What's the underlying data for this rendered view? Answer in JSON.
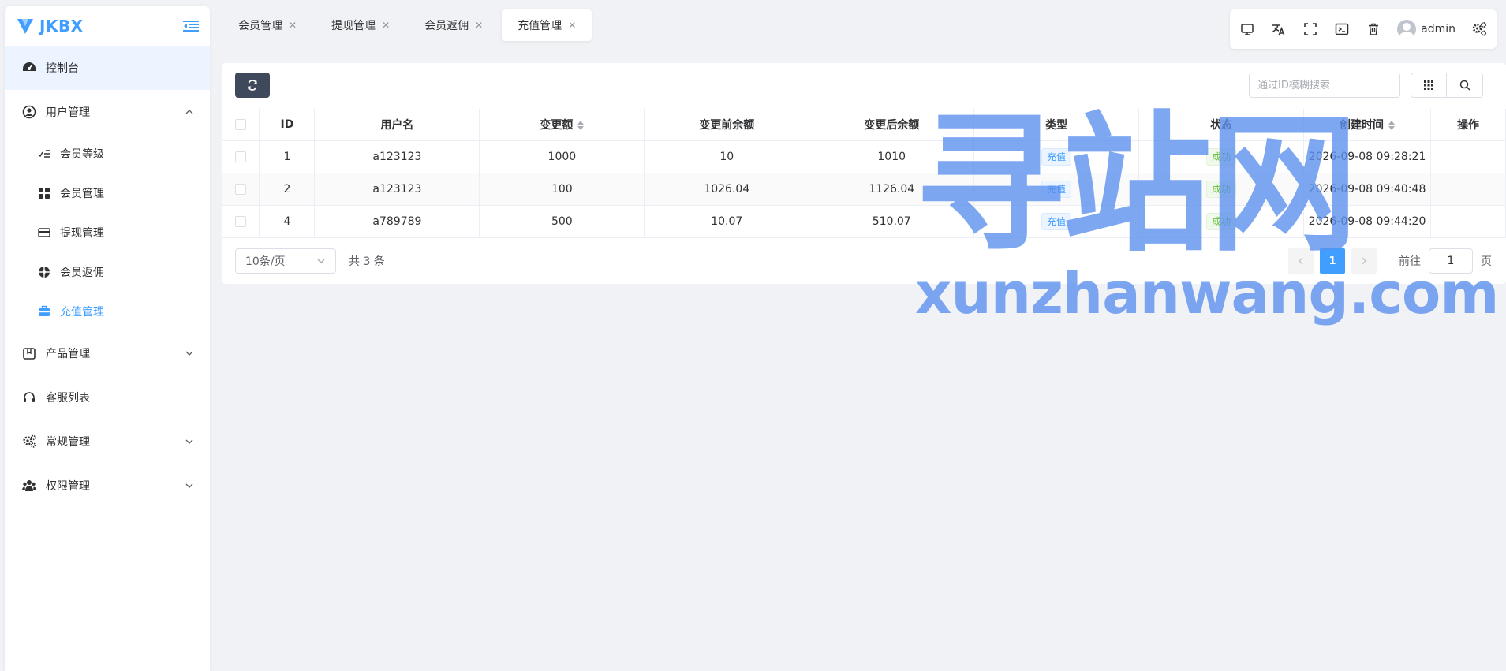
{
  "brand": {
    "name": "JKBX",
    "color": "#409eff"
  },
  "sidebar": {
    "items": [
      {
        "label": "控制台",
        "icon": "dashboard-icon",
        "active": true
      },
      {
        "label": "用户管理",
        "icon": "user-circle-icon",
        "expanded": true,
        "children": [
          {
            "label": "会员等级",
            "icon": "list-check-icon"
          },
          {
            "label": "会员管理",
            "icon": "grid-icon"
          },
          {
            "label": "提现管理",
            "icon": "credit-card-icon"
          },
          {
            "label": "会员返佣",
            "icon": "aperture-icon"
          },
          {
            "label": "充值管理",
            "icon": "briefcase-icon",
            "active": true
          }
        ]
      },
      {
        "label": "产品管理",
        "icon": "package-icon"
      },
      {
        "label": "客服列表",
        "icon": "headset-icon"
      },
      {
        "label": "常规管理",
        "icon": "cogs-icon"
      },
      {
        "label": "权限管理",
        "icon": "users-icon"
      }
    ]
  },
  "tabs": [
    {
      "label": "会员管理"
    },
    {
      "label": "提现管理"
    },
    {
      "label": "会员返佣"
    },
    {
      "label": "充值管理",
      "active": true
    }
  ],
  "toolbar": {
    "username": "admin"
  },
  "search": {
    "placeholder": "通过ID模糊搜索",
    "value": ""
  },
  "table": {
    "headers": [
      "ID",
      "用户名",
      "变更额",
      "变更前余额",
      "变更后余额",
      "类型",
      "状态",
      "创建时间",
      "操作"
    ],
    "rows": [
      {
        "id": "1",
        "username": "a123123",
        "amount": "1000",
        "before": "10",
        "after": "1010",
        "type": "充值",
        "status": "成功",
        "created": "2026-09-08 09:28:21"
      },
      {
        "id": "2",
        "username": "a123123",
        "amount": "100",
        "before": "1026.04",
        "after": "1126.04",
        "type": "充值",
        "status": "成功",
        "created": "2026-09-08 09:40:48"
      },
      {
        "id": "4",
        "username": "a789789",
        "amount": "500",
        "before": "10.07",
        "after": "510.07",
        "type": "充值",
        "status": "成功",
        "created": "2026-09-08 09:44:20"
      }
    ]
  },
  "pagination": {
    "page_size": "10条/页",
    "total": "共 3 条",
    "current_page": "1",
    "goto_prefix": "前往",
    "goto_value": "1",
    "goto_suffix": "页"
  },
  "watermark": {
    "cn": "寻站网",
    "en": "xunzhanwang.com"
  },
  "colors": {
    "accent": "#409eff",
    "dark_button": "#40485b",
    "success": "#67c23a"
  }
}
